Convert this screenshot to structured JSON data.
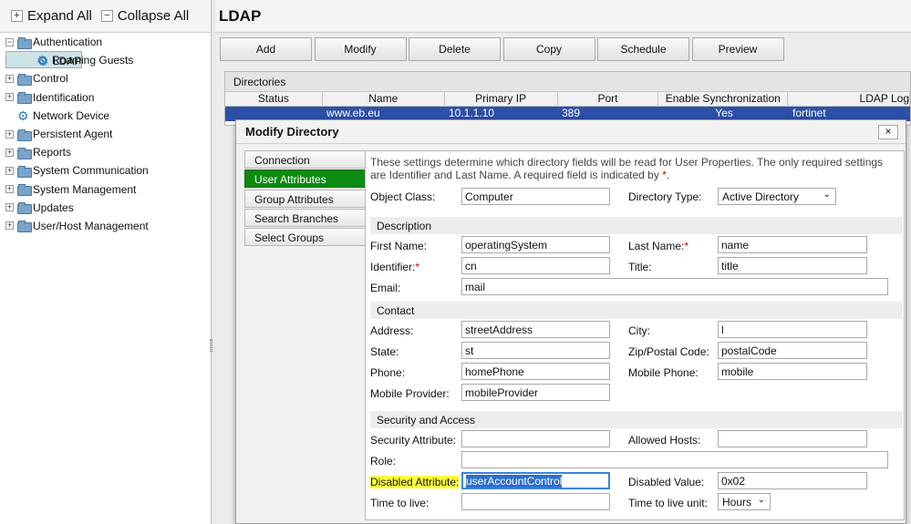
{
  "tree_toolbar": {
    "expand_all": "Expand All",
    "collapse_all": "Collapse All"
  },
  "tree": [
    {
      "label": "Authentication",
      "expanded": true,
      "icon": "folder-icon"
    },
    {
      "label": "LDAP",
      "icon": "gear-icon",
      "selected": true,
      "child": true
    },
    {
      "label": "Roaming Guests",
      "icon": "gear-icon",
      "child": true
    },
    {
      "label": "Control",
      "icon": "folder-icon"
    },
    {
      "label": "Identification",
      "icon": "folder-icon"
    },
    {
      "label": "Network Device",
      "icon": "gear-icon"
    },
    {
      "label": "Persistent Agent",
      "icon": "folder-icon"
    },
    {
      "label": "Reports",
      "icon": "folder-icon"
    },
    {
      "label": "System Communication",
      "icon": "folder-icon"
    },
    {
      "label": "System Management",
      "icon": "folder-icon"
    },
    {
      "label": "Updates",
      "icon": "folder-icon"
    },
    {
      "label": "User/Host Management",
      "icon": "folder-icon"
    }
  ],
  "page_title": "LDAP",
  "toolbar": [
    "Add",
    "Modify",
    "Delete",
    "Copy",
    "Schedule",
    "Preview"
  ],
  "directories": {
    "title": "Directories",
    "columns": [
      "Status",
      "Name",
      "Primary IP",
      "Port",
      "Enable Synchronization",
      "LDAP Log"
    ],
    "row": [
      "",
      "www.eb.eu",
      "10.1.1.10",
      "389",
      "Yes",
      "fortinet"
    ]
  },
  "modal": {
    "title": "Modify Directory",
    "close": "×",
    "tabs": [
      "Connection",
      "User Attributes",
      "Group Attributes",
      "Search Branches",
      "Select Groups"
    ],
    "active_tab": "User Attributes",
    "intro": "These settings determine which directory fields will be read for User Properties. The only required settings are Identifier and Last Name. A required field is indicated by ",
    "intro_star": "*",
    "intro_end": ".",
    "object_class_label": "Object Class:",
    "object_class": "Computer",
    "directory_type_label": "Directory Type:",
    "directory_type": "Active Directory",
    "sections": {
      "description": "Description",
      "contact": "Contact",
      "security": "Security and Access"
    },
    "fields": {
      "first_name": {
        "label": "First Name:",
        "value": "operatingSystem"
      },
      "last_name": {
        "label": "Last Name:",
        "value": "name"
      },
      "identifier": {
        "label": "Identifier:",
        "value": "cn"
      },
      "title": {
        "label": "Title:",
        "value": "title"
      },
      "email": {
        "label": "Email:",
        "value": "mail"
      },
      "address": {
        "label": "Address:",
        "value": "streetAddress"
      },
      "city": {
        "label": "City:",
        "value": "l"
      },
      "state": {
        "label": "State:",
        "value": "st"
      },
      "zip": {
        "label": "Zip/Postal Code:",
        "value": "postalCode"
      },
      "phone": {
        "label": "Phone:",
        "value": "homePhone"
      },
      "mobile_phone": {
        "label": "Mobile Phone:",
        "value": "mobile"
      },
      "mobile_provider": {
        "label": "Mobile Provider:",
        "value": "mobileProvider"
      },
      "security_attribute": {
        "label": "Security Attribute:",
        "value": ""
      },
      "allowed_hosts": {
        "label": "Allowed Hosts:",
        "value": ""
      },
      "role": {
        "label": "Role:",
        "value": ""
      },
      "disabled_attribute": {
        "label": "Disabled Attribute:",
        "value": "userAccountControl"
      },
      "disabled_value": {
        "label": "Disabled Value:",
        "value": "0x02"
      },
      "time_to_live": {
        "label": "Time to live:",
        "value": ""
      },
      "time_to_live_unit": {
        "label": "Time to live unit:",
        "value": "Hours"
      }
    },
    "required_star": "*"
  },
  "colors": {
    "active_tab": "#0c8a12",
    "selected_row": "#2c4fa8",
    "highlight": "#ffff3a",
    "required": "#cc0000"
  }
}
